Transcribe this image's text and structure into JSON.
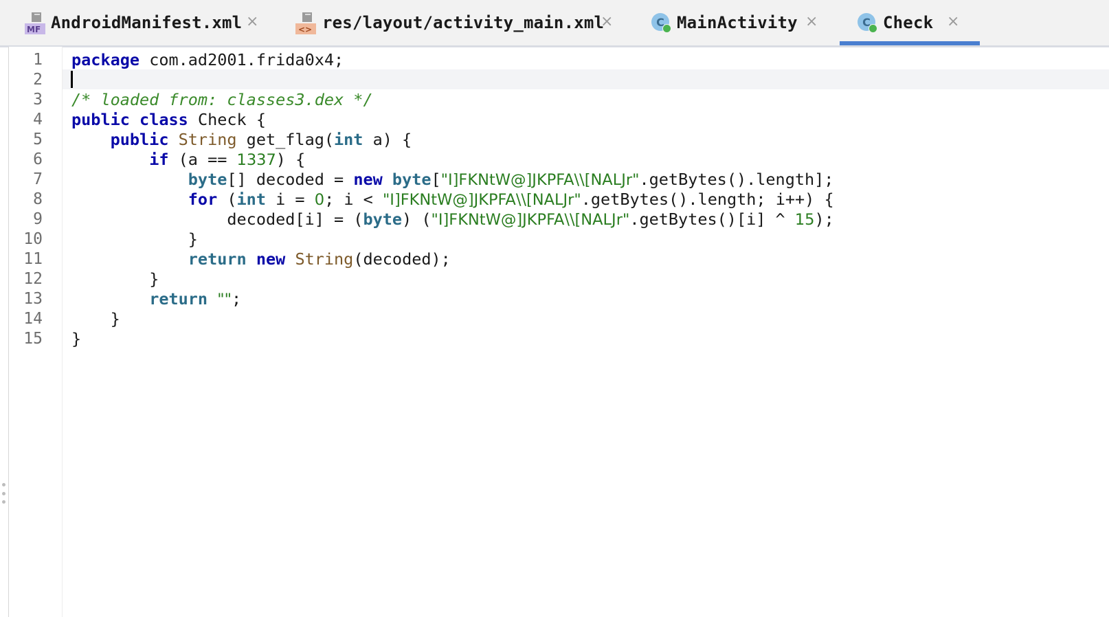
{
  "tabs": [
    {
      "label": "AndroidManifest.xml",
      "icon": "manifest-file-icon",
      "icon_text": "MF",
      "active": false
    },
    {
      "label": "res/layout/activity_main.xml",
      "icon": "layout-xml-file-icon",
      "icon_text": "<>",
      "active": false
    },
    {
      "label": "MainActivity",
      "icon": "class-icon",
      "icon_text": "C",
      "active": false
    },
    {
      "label": "Check",
      "icon": "class-icon",
      "icon_text": "C",
      "active": true
    }
  ],
  "close_glyph": "×",
  "colors": {
    "keyword": "#0a0aa8",
    "string": "#2a7d20",
    "comment": "#3a8a2a",
    "active_tab_underline": "#4a7fd0"
  },
  "editor": {
    "line_numbers": [
      "1",
      "2",
      "3",
      "4",
      "5",
      "6",
      "7",
      "8",
      "9",
      "10",
      "11",
      "12",
      "13",
      "14",
      "15"
    ],
    "caret_line": 2,
    "lines": {
      "l1": {
        "kw_package": "package",
        "rest": " com.ad2001.frida0x4;"
      },
      "l3": {
        "comment": "/* loaded from: classes3.dex */"
      },
      "l4": {
        "kw_public": "public",
        "kw_class": "class",
        "rest": " Check {"
      },
      "l5": {
        "kw_public": "public",
        "type_string": "String",
        "name": " get_flag(",
        "kw_int": "int",
        "rest": " a) {"
      },
      "l6": {
        "kw_if": "if",
        "open": " (a == ",
        "num": "1337",
        "close": ") {"
      },
      "l7": {
        "kw_byte": "byte",
        "mid": "[] decoded = ",
        "kw_new": "new",
        "kw_byte2": "byte",
        "open": "[",
        "str": "\"I]FKNtW@]JKPFA\\\\[NALJr\"",
        "rest": ".getBytes().length];"
      },
      "l8": {
        "kw_for": "for",
        "open": " (",
        "kw_int": "int",
        "mid": " i = ",
        "num": "0",
        "mid2": "; i < ",
        "str": "\"I]FKNtW@]JKPFA\\\\[NALJr\"",
        "rest": ".getBytes().length; i++) {"
      },
      "l9": {
        "lead": "decoded[i] = (",
        "kw_byte": "byte",
        "mid": ") (",
        "str": "\"I]FKNtW@]JKPFA\\\\[NALJr\"",
        "mid2": ".getBytes()[i] ^ ",
        "num": "15",
        "rest": ");"
      },
      "l10": {
        "rest": "}"
      },
      "l11": {
        "kw_return": "return",
        "kw_new": "new",
        "type_string": "String",
        "rest": "(decoded);"
      },
      "l12": {
        "rest": "}"
      },
      "l13": {
        "kw_return": "return",
        "str": "\"\"",
        "rest": ";"
      },
      "l14": {
        "rest": "}"
      },
      "l15": {
        "rest": "}"
      }
    }
  }
}
